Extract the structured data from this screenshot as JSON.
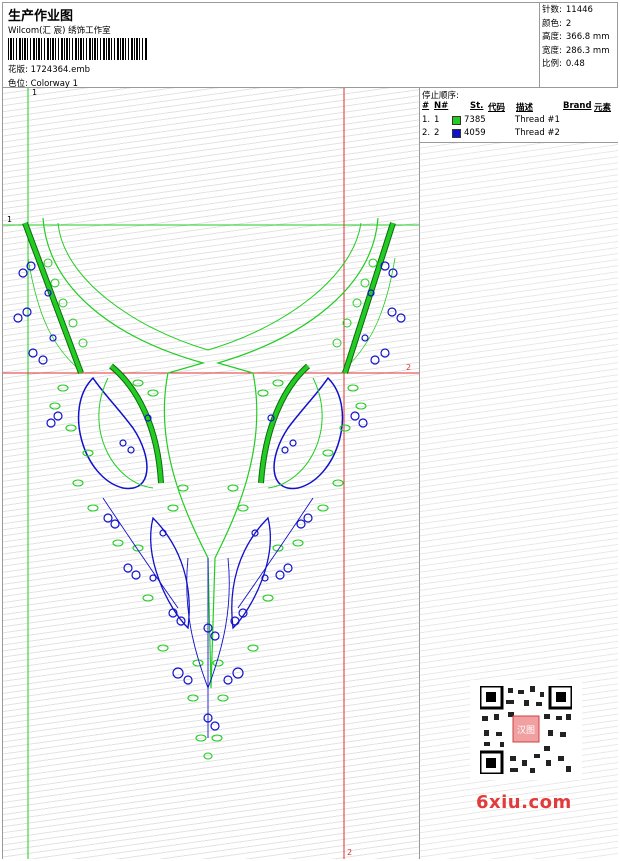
{
  "header": {
    "title": "生产作业图",
    "company": "Wilcom(汇 宸) 绣饰工作室",
    "design_label": "花版:",
    "design_value": "1724364.emb",
    "colorway_label": "色位:",
    "colorway_value": "Colorway 1"
  },
  "stats": [
    {
      "label": "针数:",
      "value": "11446"
    },
    {
      "label": "颜色:",
      "value": "2"
    },
    {
      "label": "高度:",
      "value": "366.8 mm"
    },
    {
      "label": "宽度:",
      "value": "286.3 mm"
    },
    {
      "label": "比例:",
      "value": "0.48"
    }
  ],
  "stop_sequence": {
    "title": "停止顺序:",
    "columns": [
      "#",
      "N#",
      "St.",
      "代码",
      "描述",
      "Brand",
      "元素"
    ],
    "rows": [
      {
        "idx": "1.",
        "n": "1",
        "color": "#22cc22",
        "code": "7385",
        "desc": "Thread #1"
      },
      {
        "idx": "2.",
        "n": "2",
        "color": "#1111cc",
        "code": "4059",
        "desc": "Thread #2"
      }
    ]
  },
  "guides": {
    "vertical_1": "1",
    "horizontal_1": "1",
    "horizontal_2": "2",
    "vertical_2": "2"
  },
  "watermark": "6xiu.com",
  "qr_badge": "汉图"
}
